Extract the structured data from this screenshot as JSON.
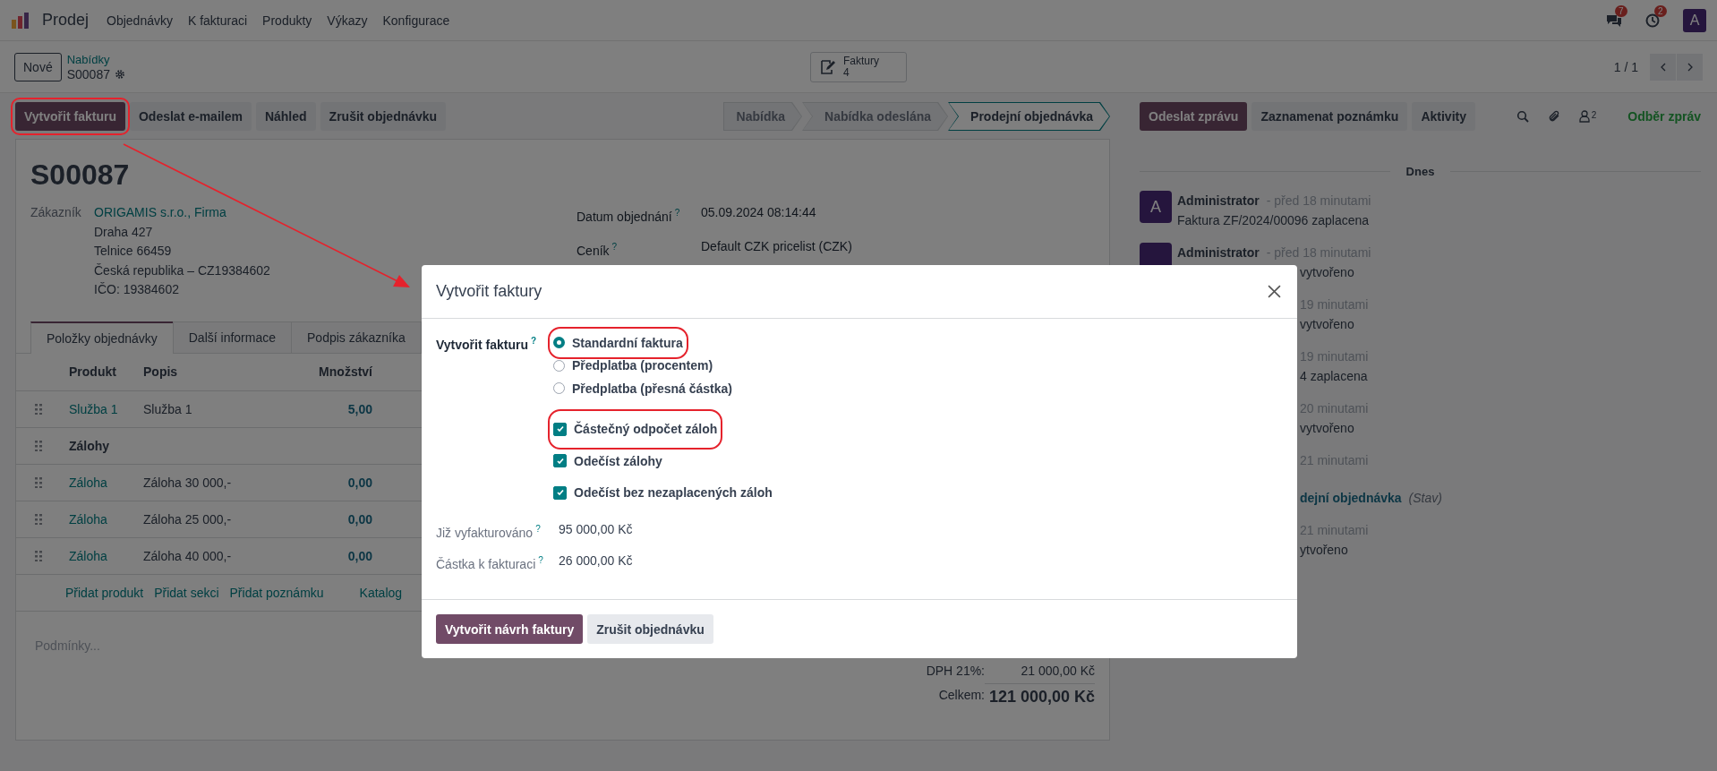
{
  "top_nav": {
    "app_name": "Prodej",
    "menu": [
      "Objednávky",
      "K fakturaci",
      "Produkty",
      "Výkazy",
      "Konfigurace"
    ],
    "chat_badge": "7",
    "activity_badge": "2",
    "avatar": "A"
  },
  "control_panel": {
    "new_button": "Nové",
    "breadcrumb": "Nabídky",
    "record": "S00087",
    "smart_button": {
      "label": "Faktury",
      "count": "4"
    },
    "pager": "1 / 1"
  },
  "actions": [
    {
      "label": "Vytvořit fakturu",
      "primary": true,
      "highlighted": true
    },
    {
      "label": "Odeslat e-mailem",
      "primary": false,
      "highlighted": false
    },
    {
      "label": "Náhled",
      "primary": false,
      "highlighted": false
    },
    {
      "label": "Zrušit objednávku",
      "primary": false,
      "highlighted": false
    }
  ],
  "statusbar": [
    {
      "label": "Nabídka",
      "selected": false
    },
    {
      "label": "Nabídka odeslána",
      "selected": false
    },
    {
      "label": "Prodejní objednávka",
      "selected": true
    }
  ],
  "form": {
    "title": "S00087",
    "customer_label": "Zákazník",
    "customer": "ORIGAMIS s.r.o., Firma",
    "address": [
      "Draha 427",
      "Telnice 66459",
      "Česká republika – CZ19384602",
      "IČO: 19384602"
    ],
    "fields": [
      {
        "label": "Datum objednání",
        "help": "?",
        "value": "05.09.2024 08:14:44"
      },
      {
        "label": "Ceník",
        "help": "?",
        "value": "Default CZK pricelist (CZK)"
      }
    ],
    "tabs": [
      {
        "label": "Položky objednávky",
        "selected": true
      },
      {
        "label": "Další informace",
        "selected": false
      },
      {
        "label": "Podpis zákazníka",
        "selected": false
      }
    ],
    "table": {
      "columns": [
        "Produkt",
        "Popis",
        "Množství"
      ],
      "rows": [
        {
          "kind": "line",
          "product": "Služba 1",
          "description": "Služba 1",
          "quantity": "5,00"
        },
        {
          "kind": "section",
          "name": "Zálohy"
        },
        {
          "kind": "line",
          "product": "Záloha",
          "description": "Záloha 30 000,-",
          "quantity": "0,00"
        },
        {
          "kind": "line",
          "product": "Záloha",
          "description": "Záloha 25 000,-",
          "quantity": "0,00"
        },
        {
          "kind": "line",
          "product": "Záloha",
          "description": "Záloha 40 000,-",
          "quantity": "0,00"
        }
      ]
    },
    "add_links": [
      "Přidat produkt",
      "Přidat sekci",
      "Přidat poznámku",
      "Katalog"
    ],
    "terms_placeholder": "Podmínky...",
    "totals": [
      {
        "label": "DPH 21%:",
        "value": "21 000,00 Kč",
        "grand": false
      },
      {
        "label": "Celkem:",
        "value": "121 000,00 Kč",
        "grand": true
      }
    ]
  },
  "chatter": {
    "buttons": [
      {
        "label": "Odeslat zprávu",
        "primary": true
      },
      {
        "label": "Zaznamenat poznámku",
        "primary": false
      },
      {
        "label": "Aktivity",
        "primary": false
      }
    ],
    "followers": "2",
    "follow": "Odběr zpráv",
    "date": "Dnes",
    "messages": [
      {
        "kind": "message",
        "avatar": "A",
        "author": "Administrator",
        "time": "- před 18 minutami",
        "body": "Faktura ZF/2024/00096 zaplacena"
      },
      {
        "kind": "message",
        "author": "Administrator",
        "time": "- před 18 minutami",
        "body": "vytvořeno"
      },
      {
        "kind": "message",
        "time": "19 minutami",
        "body": "vytvořeno"
      },
      {
        "kind": "message",
        "time": "19 minutami",
        "body": "4 zaplacena"
      },
      {
        "kind": "message",
        "time": "20 minutami",
        "body": "vytvořeno"
      },
      {
        "kind": "tracking",
        "time": "21 minutami",
        "value": "dejní objednávka",
        "field": "(Stav)"
      },
      {
        "kind": "message",
        "time": "21 minutami",
        "body": "ytvořeno"
      }
    ]
  },
  "dialog": {
    "title": "Vytvořit faktury",
    "label": "Vytvořit fakturu",
    "help": "?",
    "options": [
      {
        "label": "Standardní faktura",
        "selected": true,
        "highlighted": true
      },
      {
        "label": "Předplatba (procentem)",
        "selected": false,
        "highlighted": false
      },
      {
        "label": "Předplatba (přesná částka)",
        "selected": false,
        "highlighted": false
      }
    ],
    "checks": [
      {
        "label": "Částečný odpočet záloh",
        "checked": true,
        "highlighted": true
      },
      {
        "label": "Odečíst zálohy",
        "checked": true,
        "highlighted": false
      },
      {
        "label": "Odečíst bez nezaplacených záloh",
        "checked": true,
        "highlighted": false
      }
    ],
    "amounts": [
      {
        "label": "Již vyfakturováno",
        "help": "?",
        "value": "95 000,00 Kč"
      },
      {
        "label": "Částka k fakturaci",
        "help": "?",
        "value": "26 000,00 Kč"
      }
    ],
    "buttons": [
      {
        "label": "Vytvořit návrh faktury",
        "primary": true
      },
      {
        "label": "Zrušit objednávku",
        "primary": false
      }
    ]
  }
}
